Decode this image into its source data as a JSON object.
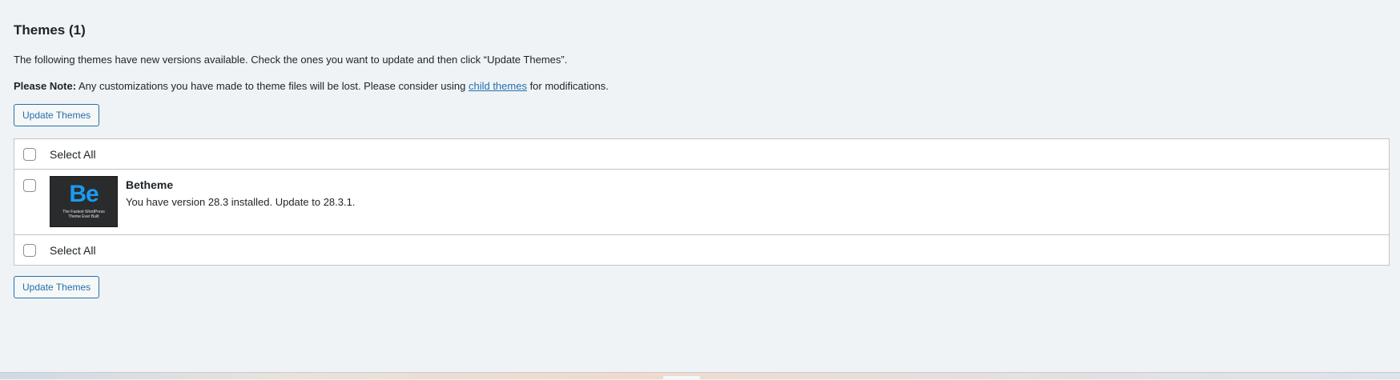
{
  "section": {
    "title": "Themes (1)",
    "intro": "The following themes have new versions available. Check the ones you want to update and then click “Update Themes”.",
    "note_label": "Please Note:",
    "note_text_before": " Any customizations you have made to theme files will be lost. Please consider using ",
    "note_link": "child themes",
    "note_text_after": " for modifications."
  },
  "buttons": {
    "update_top": "Update Themes",
    "update_bottom": "Update Themes"
  },
  "table": {
    "select_all_top": "Select All",
    "select_all_bottom": "Select All",
    "themes": [
      {
        "name": "Betheme",
        "description": "You have version 28.3 installed. Update to 28.3.1.",
        "thumbnail_logo": "Be",
        "thumbnail_tagline_line1": "The Fastest WordPress",
        "thumbnail_tagline_line2": "Theme Ever Built",
        "checked": false
      }
    ]
  },
  "colors": {
    "accent": "#2271b1",
    "logo_blue": "#1b9bf0",
    "background": "#f0f3f6"
  },
  "icons": {
    "checkbox": "checkbox-unchecked-icon"
  }
}
